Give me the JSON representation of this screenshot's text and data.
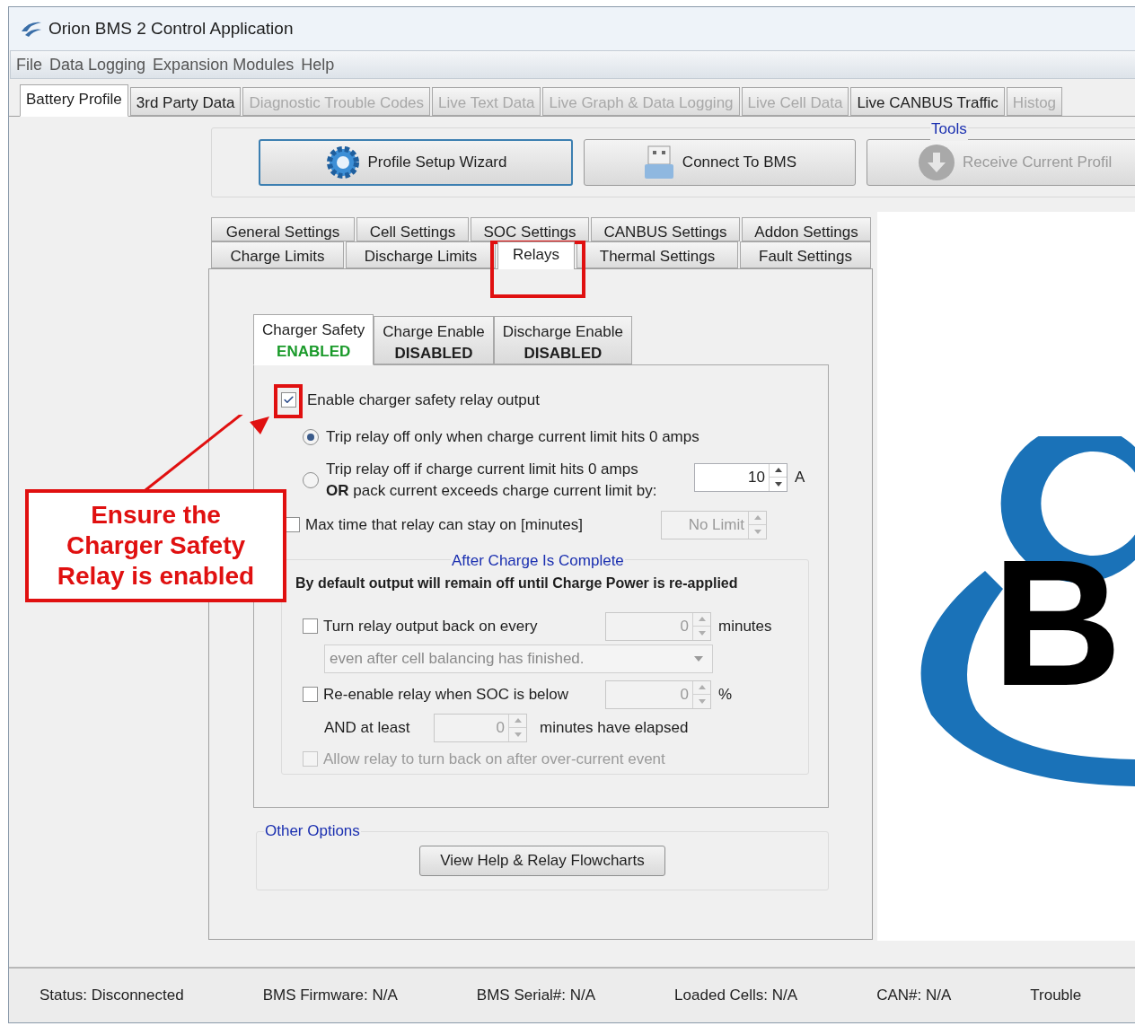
{
  "window": {
    "title": "Orion BMS 2 Control Application"
  },
  "menu": [
    "File",
    "Data Logging",
    "Expansion Modules",
    "Help"
  ],
  "tabs": [
    {
      "label": "Battery Profile",
      "selected": true,
      "disabled": false
    },
    {
      "label": "3rd Party Data",
      "selected": false,
      "disabled": false
    },
    {
      "label": "Diagnostic Trouble Codes",
      "selected": false,
      "disabled": true
    },
    {
      "label": "Live Text Data",
      "selected": false,
      "disabled": true
    },
    {
      "label": "Live Graph & Data Logging",
      "selected": false,
      "disabled": true
    },
    {
      "label": "Live Cell Data",
      "selected": false,
      "disabled": true
    },
    {
      "label": "Live CANBUS Traffic",
      "selected": false,
      "disabled": false
    },
    {
      "label": "Histog",
      "selected": false,
      "disabled": true
    }
  ],
  "tools": {
    "title": "Tools",
    "buttons": [
      {
        "label": "Profile Setup Wizard",
        "kind": "wizard",
        "disabled": false,
        "focused": true
      },
      {
        "label": "Connect To BMS",
        "kind": "usb",
        "disabled": false,
        "focused": false
      },
      {
        "label": "Receive Current Profil",
        "kind": "download",
        "disabled": true,
        "focused": false
      }
    ]
  },
  "settings_tab_rows": [
    {
      "tabs": [
        {
          "label": "General Settings",
          "selected": false
        },
        {
          "label": "Cell Settings",
          "selected": false
        },
        {
          "label": "SOC Settings",
          "selected": false
        },
        {
          "label": "CANBUS Settings",
          "selected": false
        },
        {
          "label": "Addon Settings",
          "selected": false
        }
      ]
    },
    {
      "tabs": [
        {
          "label": "Charge Limits",
          "selected": false
        },
        {
          "label": "Discharge Limits",
          "selected": false
        },
        {
          "label": "Relays",
          "selected": true
        },
        {
          "label": "Thermal Settings",
          "selected": false
        },
        {
          "label": "Fault Settings",
          "selected": false
        }
      ]
    }
  ],
  "relay_tabs": [
    {
      "label": "Charger Safety",
      "status": "ENABLED",
      "enabled": true,
      "selected": true
    },
    {
      "label": "Charge Enable",
      "status": "DISABLED",
      "enabled": false,
      "selected": false
    },
    {
      "label": "Discharge Enable",
      "status": "DISABLED",
      "enabled": false,
      "selected": false
    }
  ],
  "charger_safety": {
    "enable": {
      "label": "Enable charger safety relay output",
      "checked": true
    },
    "modes": [
      {
        "lines": [
          "Trip relay off only when charge current limit hits 0 amps"
        ],
        "selected": true
      },
      {
        "lines": [
          "Trip relay off if charge current limit hits 0 amps",
          "**OR** pack current exceeds charge current limit by:"
        ],
        "selected": false,
        "value": "10",
        "unit": "A"
      }
    ],
    "max_time": {
      "label": "Max time that relay can stay on [minutes]",
      "checked": false,
      "value": "No Limit",
      "disabled": true
    },
    "after_charge": {
      "title": "After Charge Is Complete",
      "note": "By default output will remain off until Charge Power is re-applied",
      "turn_back_on": {
        "label": "Turn relay output back on every",
        "checked": false,
        "value": "0",
        "unit": "minutes",
        "disabled": true
      },
      "balancing": {
        "value": "even after cell balancing has finished.",
        "disabled": true
      },
      "reenable": {
        "label": "Re-enable relay when SOC is below",
        "checked": false,
        "value": "0",
        "unit": "%",
        "disabled": true
      },
      "and_at_least": {
        "label": "AND at least",
        "value": "0",
        "unit": "minutes have elapsed",
        "disabled": true
      },
      "allow_overcurrent": {
        "label": "Allow relay to turn back on after over-current event",
        "checked": false,
        "disabled": true
      }
    }
  },
  "other_options": {
    "title": "Other Options",
    "button": "View Help & Relay Flowcharts"
  },
  "logo": {
    "letter": "B"
  },
  "status_bar": [
    "Status: Disconnected",
    "BMS Firmware: N/A",
    "BMS Serial#: N/A",
    "Loaded Cells: N/A",
    "CAN#: N/A",
    "Trouble"
  ],
  "annotation": {
    "lines": [
      "Ensure the",
      "Charger Safety",
      "Relay is enabled"
    ]
  }
}
